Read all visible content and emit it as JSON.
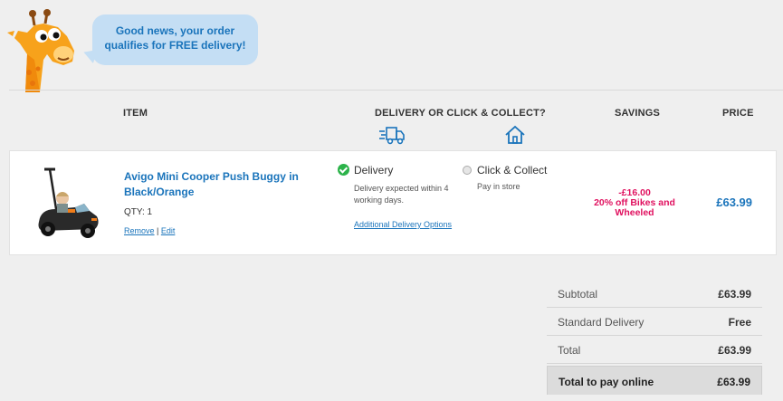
{
  "banner": {
    "message": "Good news, your order qualifies for FREE delivery!"
  },
  "table_headers": {
    "item": "ITEM",
    "delivery": "DELIVERY OR CLICK & COLLECT?",
    "savings": "SAVINGS",
    "price": "PRICE"
  },
  "item": {
    "title": "Avigo Mini Cooper Push Buggy in Black/Orange",
    "qty": "QTY: 1",
    "remove_label": "Remove",
    "separator": " | ",
    "edit_label": "Edit",
    "delivery_label": "Delivery",
    "delivery_note": "Delivery expected within 4 working days.",
    "additional_options": "Additional Delivery Options",
    "collect_label": "Click & Collect",
    "collect_note": "Pay in store",
    "savings_amount": "-£16.00",
    "savings_desc": "20% off Bikes and Wheeled",
    "price": "£63.99"
  },
  "summary": [
    {
      "label": "Subtotal",
      "value": "£63.99"
    },
    {
      "label": "Standard Delivery",
      "value": "Free"
    },
    {
      "label": "Total",
      "value": "£63.99"
    }
  ],
  "total_pay": {
    "label": "Total to pay online",
    "value": "£63.99"
  },
  "colors": {
    "accent": "#1a74bb",
    "savings": "#e0115f",
    "check": "#2cb34a",
    "bubble": "#c4def4"
  }
}
